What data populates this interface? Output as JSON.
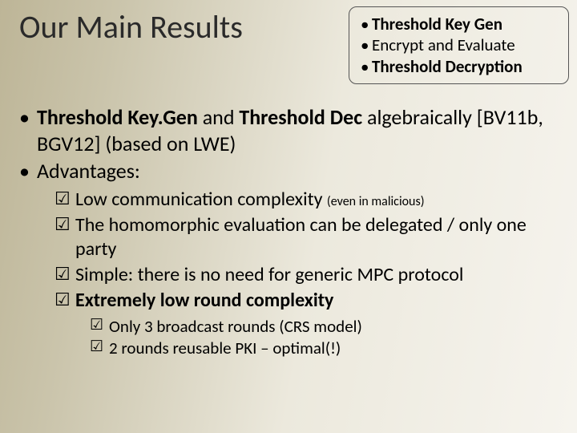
{
  "title": "Our Main Results",
  "callout": {
    "items": [
      {
        "text": "Threshold Key Gen",
        "bold": true
      },
      {
        "text": "Encrypt and Evaluate",
        "bold": false
      },
      {
        "text": "Threshold Decryption",
        "bold": true
      }
    ]
  },
  "body": {
    "bullets": [
      {
        "segments": [
          {
            "t": "Threshold Key.Gen",
            "bold": true
          },
          {
            "t": " and ",
            "bold": false
          },
          {
            "t": "Threshold Dec",
            "bold": true
          },
          {
            "t": " algebraically [BV11b, BGV12] (based on LWE)",
            "bold": false
          }
        ]
      },
      {
        "segments": [
          {
            "t": "Advantages:",
            "bold": false
          }
        ],
        "sub1": [
          {
            "segments": [
              {
                "t": "Low communication complexity ",
                "bold": false
              },
              {
                "t": "(even in malicious)",
                "bold": false,
                "small": true
              }
            ]
          },
          {
            "segments": [
              {
                "t": "The homomorphic evaluation can be delegated / only one party",
                "bold": false
              }
            ]
          },
          {
            "segments": [
              {
                "t": "Simple: there is no need for generic MPC protocol",
                "bold": false
              }
            ]
          },
          {
            "segments": [
              {
                "t": "Extremely low round complexity",
                "bold": true
              }
            ],
            "sub2": [
              {
                "segments": [
                  {
                    "t": "Only 3 broadcast rounds (CRS model)",
                    "bold": false
                  }
                ]
              },
              {
                "segments": [
                  {
                    "t": "2 rounds reusable PKI – optimal(!)",
                    "bold": false
                  }
                ]
              }
            ]
          }
        ]
      }
    ]
  }
}
